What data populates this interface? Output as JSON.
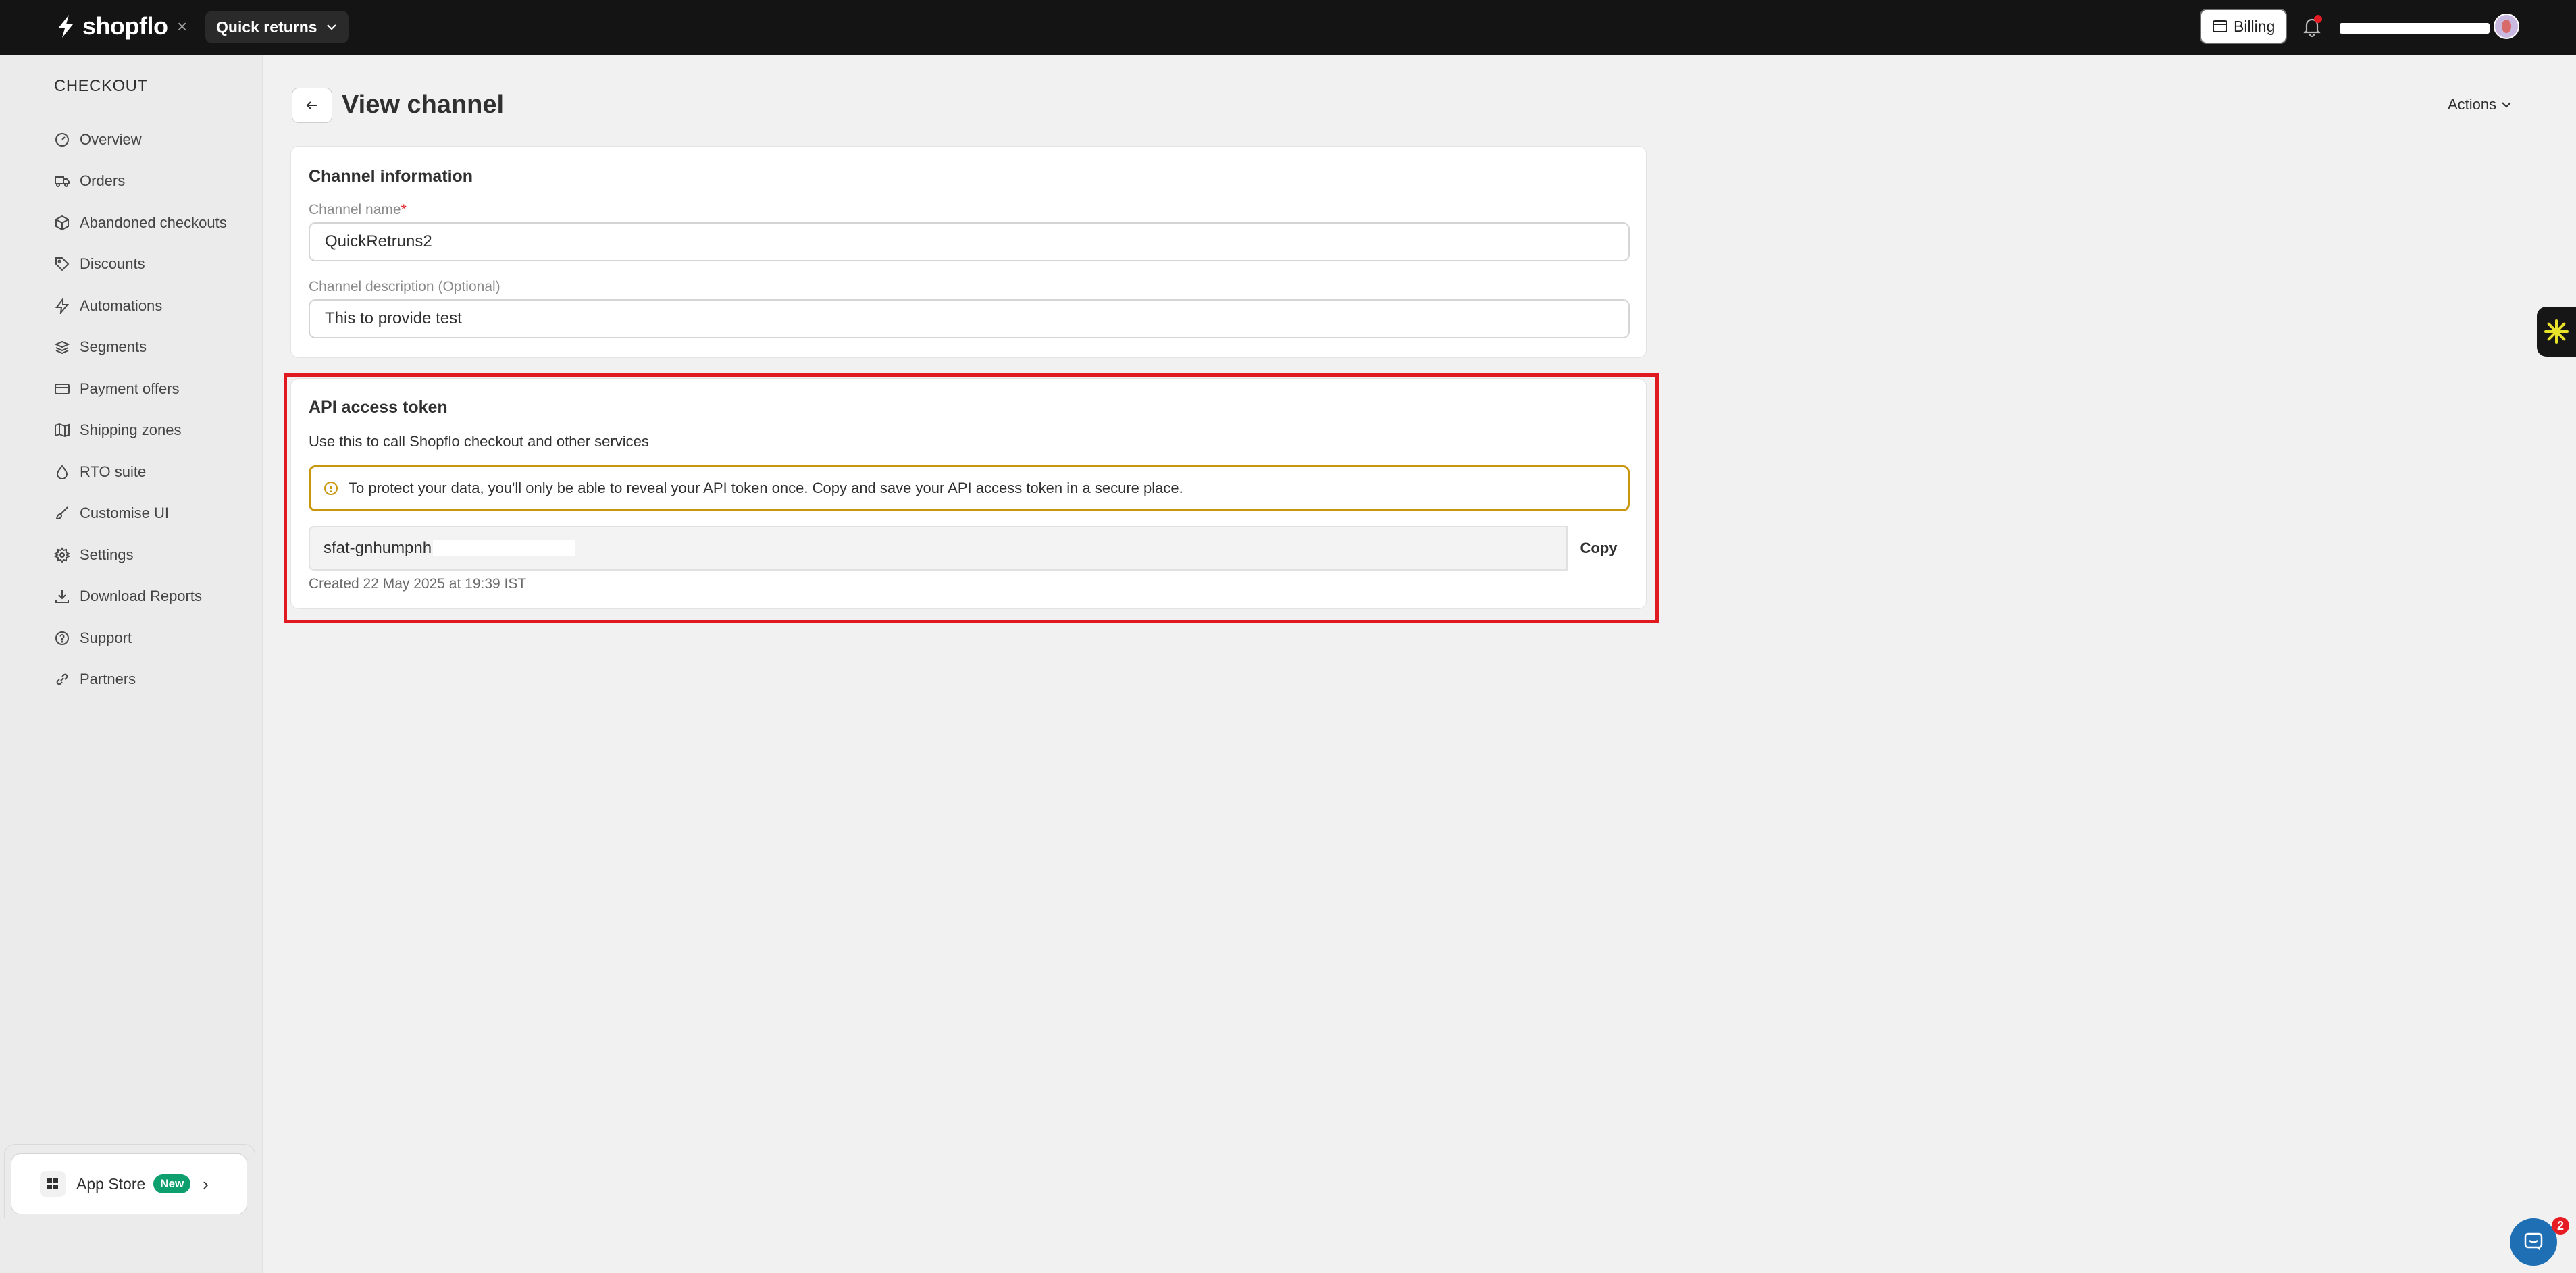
{
  "topbar": {
    "logo_text": "shopflo",
    "close_symbol": "×",
    "store_name": "Quick returns",
    "billing_label": "Billing"
  },
  "sidebar": {
    "heading": "CHECKOUT",
    "items": [
      {
        "label": "Overview",
        "icon": "gauge-icon"
      },
      {
        "label": "Orders",
        "icon": "truck-icon"
      },
      {
        "label": "Abandoned checkouts",
        "icon": "package-icon"
      },
      {
        "label": "Discounts",
        "icon": "tag-icon"
      },
      {
        "label": "Automations",
        "icon": "lightning-icon"
      },
      {
        "label": "Segments",
        "icon": "segments-icon"
      },
      {
        "label": "Payment offers",
        "icon": "card-icon"
      },
      {
        "label": "Shipping zones",
        "icon": "map-icon"
      },
      {
        "label": "RTO suite",
        "icon": "drop-icon"
      },
      {
        "label": "Customise UI",
        "icon": "brush-icon"
      },
      {
        "label": "Settings",
        "icon": "gear-icon"
      },
      {
        "label": "Download Reports",
        "icon": "download-icon"
      },
      {
        "label": "Support",
        "icon": "help-icon"
      },
      {
        "label": "Partners",
        "icon": "link-icon"
      }
    ],
    "app_store": {
      "label": "App Store",
      "badge": "New"
    }
  },
  "page": {
    "title": "View channel",
    "actions_label": "Actions"
  },
  "channel_info": {
    "title": "Channel information",
    "name_label": "Channel name",
    "name_required": "*",
    "name_value": "QuickRetruns2",
    "desc_label": "Channel description (Optional)",
    "desc_value": "This to provide test"
  },
  "api_token": {
    "title": "API access token",
    "description": "Use this to call Shopflo checkout and other services",
    "warning": "To protect your data, you'll only be able to reveal your API token once. Copy and save your API access token in a secure place.",
    "token_prefix": "sfat-gnhumpnh",
    "copy_label": "Copy",
    "created": "Created 22 May 2025 at 19:39 IST"
  },
  "chat": {
    "badge_count": "2"
  },
  "colors": {
    "topbar": "#141414",
    "highlight": "#e0181f",
    "warning_border": "#c9960c",
    "new_badge": "#0e9f6e"
  }
}
